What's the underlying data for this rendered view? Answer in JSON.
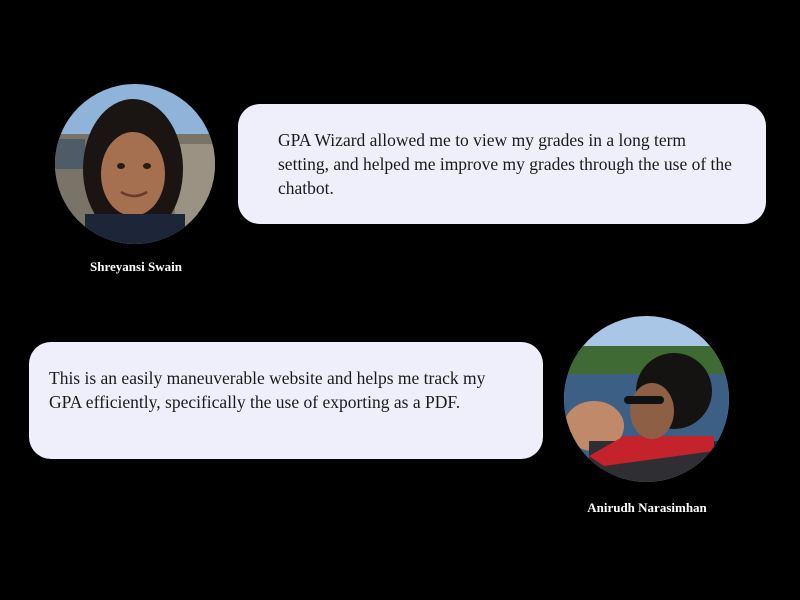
{
  "testimonials": [
    {
      "name": "Shreyansi Swain",
      "quote": "GPA Wizard allowed me to view my grades in a long term setting, and helped me improve my grades through the use of the chatbot.",
      "avatar_icon": "person-photo"
    },
    {
      "name": "Anirudh Narasimhan",
      "quote": "This is an easily maneuverable website and helps me track my GPA efficiently, specifically the use of exporting as a PDF.",
      "avatar_icon": "person-photo"
    }
  ],
  "colors": {
    "background": "#000000",
    "bubble": "#efeffc",
    "name_text": "#ffffff"
  }
}
